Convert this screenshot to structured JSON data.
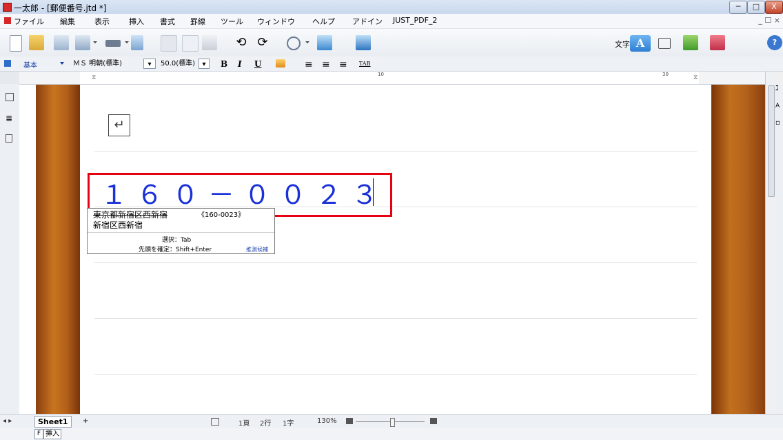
{
  "window": {
    "title": "一太郎 - [郵便番号.jtd *]",
    "minimize": "─",
    "maximize": "□",
    "close": "X",
    "mdi_controls": "_ ☐ ×"
  },
  "menubar": {
    "items": [
      "ファイル",
      "編集",
      "表示",
      "挿入",
      "書式",
      "罫線",
      "ツール",
      "ウィンドウ",
      "ヘルプ",
      "アドイン",
      "JUST_PDF_2"
    ]
  },
  "toolbar": {
    "icons": [
      "new-doc-icon",
      "open-icon",
      "save-icon",
      "save-as-icon",
      "print-icon",
      "print-preview-icon",
      "cut-icon",
      "copy-icon",
      "paste-icon",
      "undo-icon",
      "redo-icon",
      "search-icon",
      "jump-icon",
      "help-icon"
    ],
    "moji_label": "文字",
    "mode_a": "A"
  },
  "formatbar": {
    "style": "基本",
    "font": "ＭＳ 明朝(標準)",
    "size": "50.0(標準)",
    "bold": "B",
    "italic": "I",
    "underline": "U",
    "tab": "TAB"
  },
  "ruler": {
    "mark_10": "10",
    "mark_30": "30"
  },
  "document": {
    "postal_code": "１６０－００２３",
    "para_mark": "↵"
  },
  "ime_popup": {
    "candidate1": "東京都新宿区西新宿",
    "candidate1_code": "《160-0023》",
    "candidate2": "新宿区西新宿",
    "hint_select": "選択：Tab",
    "hint_confirm": "先頭を確定：Shift+Enter",
    "hint_mode": "推測候補"
  },
  "statusbar": {
    "sheet_tab": "Sheet1",
    "add_sheet": "+",
    "page": "1頁",
    "line": "2行",
    "char": "1字",
    "zoom": "130%"
  },
  "bottombar": {
    "f_key": "F",
    "insert_mode": "挿入"
  },
  "colors": {
    "postal_text": "#1a30d8",
    "highlight": "#e60012",
    "mode_active": "#2e7fd3"
  }
}
